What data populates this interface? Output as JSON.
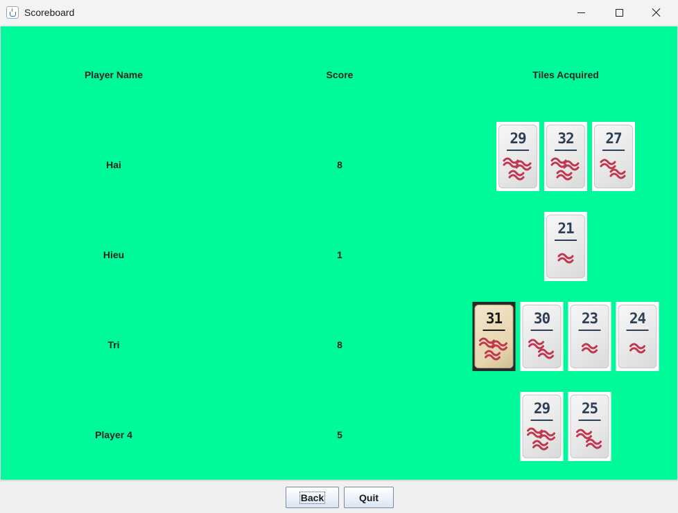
{
  "window": {
    "title": "Scoreboard",
    "accent": "#00fa9a"
  },
  "headers": {
    "player_name": "Player Name",
    "score": "Score",
    "tiles": "Tiles Acquired"
  },
  "players": [
    {
      "name": "Hai",
      "score": "8",
      "tiles": [
        {
          "n": "29",
          "worms": 3
        },
        {
          "n": "32",
          "worms": 3
        },
        {
          "n": "27",
          "worms": 2
        }
      ]
    },
    {
      "name": "Hieu",
      "score": "1",
      "tiles": [
        {
          "n": "21",
          "worms": 1
        }
      ]
    },
    {
      "name": "Tri",
      "score": "8",
      "tiles": [
        {
          "n": "31",
          "worms": 3,
          "dark": true
        },
        {
          "n": "30",
          "worms": 2
        },
        {
          "n": "23",
          "worms": 1
        },
        {
          "n": "24",
          "worms": 1
        }
      ]
    },
    {
      "name": "Player 4",
      "score": "5",
      "tiles": [
        {
          "n": "29",
          "worms": 3
        },
        {
          "n": "25",
          "worms": 2
        }
      ]
    }
  ],
  "buttons": {
    "back": "Back",
    "quit": "Quit"
  }
}
